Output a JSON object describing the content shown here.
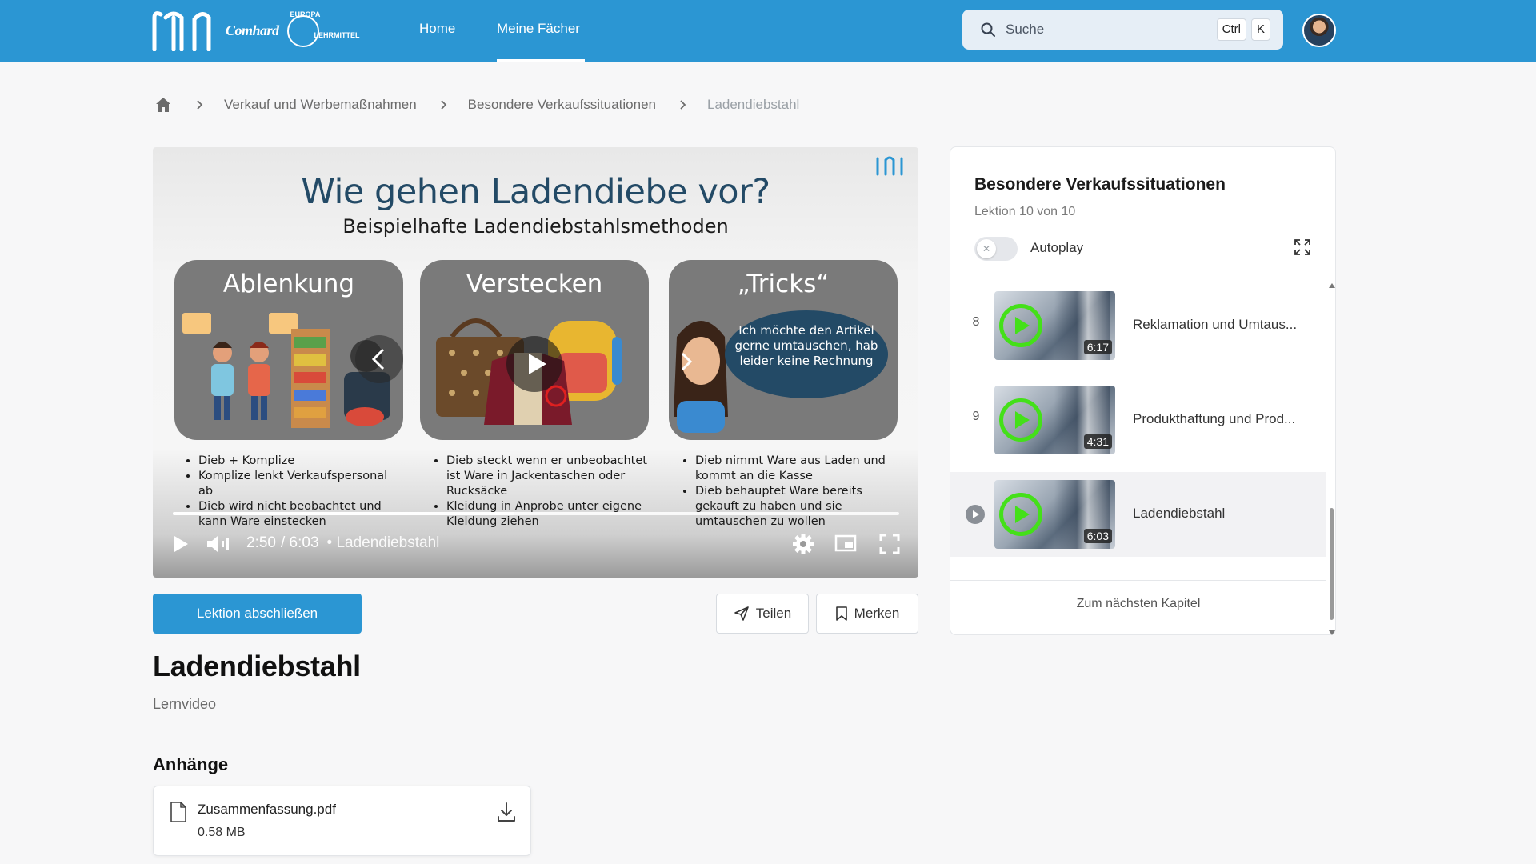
{
  "header": {
    "brand": "Comhard",
    "europa_top": "EUROPA",
    "europa_bottom": "LEHRMITTEL",
    "nav": [
      {
        "label": "Home"
      },
      {
        "label": "Meine Fächer"
      }
    ],
    "search": {
      "placeholder": "Suche",
      "kbd": [
        "Ctrl",
        "K"
      ]
    }
  },
  "breadcrumb": {
    "items": [
      "Verkauf und Werbemaßnahmen",
      "Besondere Verkaufssituationen",
      "Ladendiebstahl"
    ]
  },
  "video": {
    "slide": {
      "title": "Wie gehen Ladendiebe vor?",
      "subtitle": "Beispielhafte Ladendiebstahlsmethoden",
      "cards": [
        {
          "title": "Ablenkung",
          "bullets": [
            "Dieb + Komplize",
            "Komplize lenkt Verkaufspersonal ab",
            "Dieb wird nicht beobachtet und kann Ware einstecken"
          ]
        },
        {
          "title": "Verstecken",
          "bullets": [
            "Dieb steckt wenn er unbeobachtet ist Ware in Jackentaschen oder Rucksäcke",
            "Kleidung in Anprobe unter eigene Kleidung ziehen"
          ]
        },
        {
          "title": "„Tricks“",
          "bubble": "Ich möchte den Artikel gerne umtauschen, hab leider keine Rechnung",
          "bullets": [
            "Dieb nimmt Ware aus Laden und kommt an die Kasse",
            "Dieb behauptet Ware bereits gekauft zu haben und sie umtauschen zu wollen"
          ]
        }
      ]
    },
    "current_time": "2:50",
    "duration": "/ 6:03",
    "chapter": "• Ladendiebstahl",
    "progress": 0.47
  },
  "actions": {
    "complete": "Lektion abschließen",
    "share": "Teilen",
    "bookmark": "Merken"
  },
  "lesson": {
    "title": "Ladendiebstahl",
    "type": "Lernvideo"
  },
  "attachments": {
    "heading": "Anhänge",
    "items": [
      {
        "name": "Zusammenfassung.pdf",
        "size": "0.58 MB"
      }
    ]
  },
  "sidebar": {
    "title": "Besondere Verkaufssituationen",
    "subtitle": "Lektion 10 von 10",
    "autoplay_label": "Autoplay",
    "autoplay_on": false,
    "items": [
      {
        "num": "8",
        "title": "Reklamation und Umtaus...",
        "duration": "6:17"
      },
      {
        "num": "9",
        "title": "Produkthaftung und Prod...",
        "duration": "4:31"
      },
      {
        "num": "",
        "title": "Ladendiebstahl",
        "duration": "6:03",
        "active": true
      }
    ],
    "next_chapter": "Zum nächsten Kapitel"
  },
  "colors": {
    "primary": "#2b96d3",
    "play_green": "#44e019",
    "slide_blue": "#234a66"
  }
}
